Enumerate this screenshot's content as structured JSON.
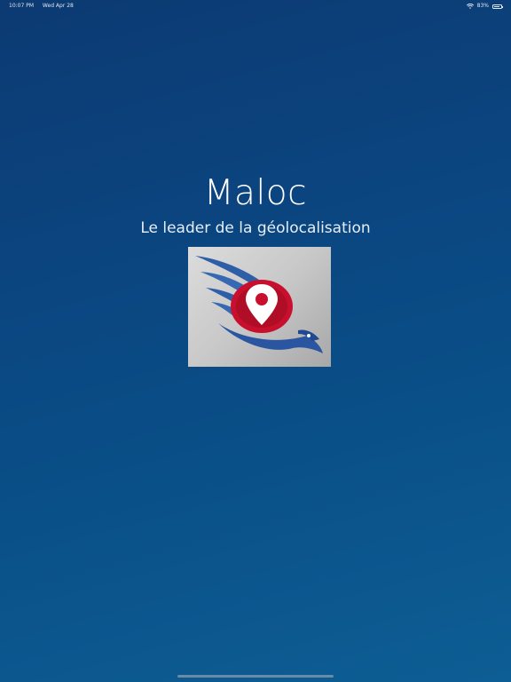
{
  "status_bar": {
    "time": "10:07 PM",
    "date": "Wed Apr 28",
    "battery": "83%",
    "battery_level": 0.83
  },
  "splash": {
    "title": "Maloc",
    "tagline": "Le leader de la géolocalisation"
  },
  "logo": {
    "icon": "eagle-location-pin-logo",
    "colors": {
      "blue": "#2f5ea8",
      "red": "#c8102e",
      "background": "#c8c8c8"
    }
  },
  "colors": {
    "background_top": "#0c3a72",
    "background_bottom": "#0d5e94"
  }
}
